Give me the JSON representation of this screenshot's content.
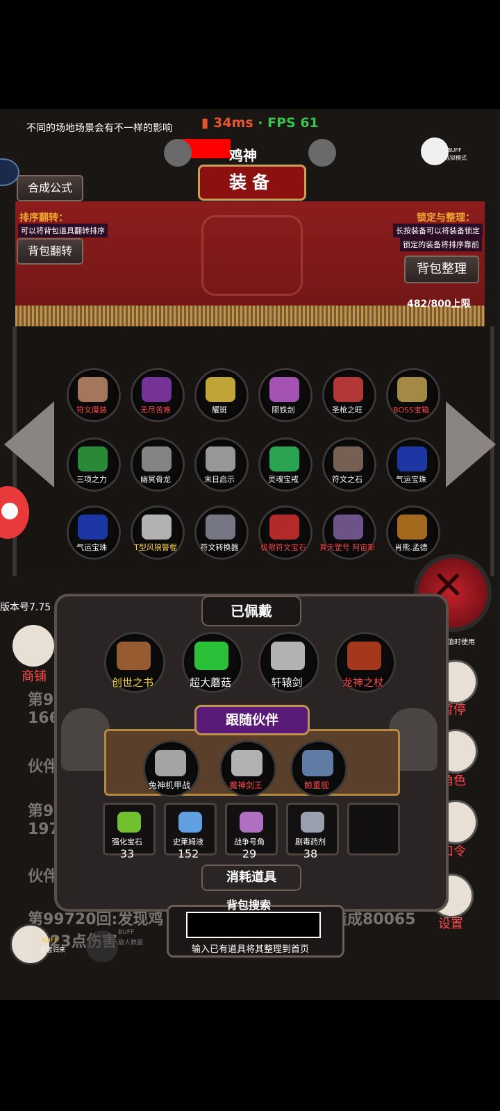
{
  "status": {
    "tip": "不同的场地场景会有不一样的影响",
    "ping": "34ms",
    "separator": " · ",
    "fps": "FPS 61"
  },
  "header": {
    "player_name": "鸡神",
    "title": "装备",
    "buff_label": "BUFF",
    "mode_label": "炼狱模式"
  },
  "left_buttons": {
    "synthesis": "合成公式",
    "sort_title": "排序翻转：",
    "sort_hint": "可以将背包道具翻转排序",
    "flip": "背包翻转"
  },
  "right_buttons": {
    "lock_title": "锁定与整理：",
    "lock_hint1": "长按装备可以将装备锁定",
    "lock_hint2": "锁定的装备将排序靠前",
    "organize": "背包整理",
    "capacity": "482/800上限"
  },
  "inventory": {
    "items": [
      {
        "name": "符文魔装",
        "color": "red",
        "icon_color": "#c08a6a"
      },
      {
        "name": "无尽苦难",
        "color": "red",
        "icon_color": "#8a3ab0"
      },
      {
        "name": "耀斑",
        "color": "white",
        "icon_color": "#e0c040"
      },
      {
        "name": "陨铁剑",
        "color": "white",
        "icon_color": "#c060d0"
      },
      {
        "name": "圣枪之旺",
        "color": "white",
        "icon_color": "#d04040"
      },
      {
        "name": "BOSS宝箱",
        "color": "red",
        "icon_color": "#c0a050"
      },
      {
        "name": "三项之力",
        "color": "white",
        "icon_color": "#30a040"
      },
      {
        "name": "幽冥骨龙",
        "color": "white",
        "icon_color": "#9a9a9a"
      },
      {
        "name": "末日启示",
        "color": "white",
        "icon_color": "#b0b0b0"
      },
      {
        "name": "灵魂宝戒",
        "color": "white",
        "icon_color": "#30c060"
      },
      {
        "name": "符文之石",
        "color": "white",
        "icon_color": "#8a7060"
      },
      {
        "name": "气运宝珠",
        "color": "white",
        "icon_color": "#2040c0"
      },
      {
        "name": "气运宝珠",
        "color": "white",
        "icon_color": "#2040c0"
      },
      {
        "name": "T型风狼警棍",
        "color": "yellow",
        "icon_color": "#d0d0d0"
      },
      {
        "name": "符文转换器",
        "color": "white",
        "icon_color": "#8a8a9a"
      },
      {
        "name": "极限符文宝石",
        "color": "red",
        "icon_color": "#d03030"
      },
      {
        "name": "真天罡号 阿宙斯",
        "color": "red",
        "icon_color": "#8060a0"
      },
      {
        "name": "肖熊.孟德",
        "color": "white",
        "icon_color": "#c07a20"
      }
    ]
  },
  "equipped": {
    "title": "已佩戴",
    "items": [
      {
        "name": "创世之书",
        "color": "yellow",
        "icon_color": "#b06a3a"
      },
      {
        "name": "超大蘑菇",
        "color": "white",
        "icon_color": "#30e040"
      },
      {
        "name": "轩辕剑",
        "color": "white",
        "icon_color": "#d0d0d0"
      },
      {
        "name": "龙神之杖",
        "color": "red",
        "icon_color": "#c04020"
      }
    ]
  },
  "partners": {
    "title": "跟随伙伴",
    "items": [
      {
        "name": "兔神机甲战",
        "color": "white",
        "icon_color": "#c0c0c0"
      },
      {
        "name": "魔神剑王",
        "color": "red",
        "icon_color": "#d0d0d0"
      },
      {
        "name": "鲸重舰",
        "color": "red",
        "icon_color": "#7090c0"
      }
    ]
  },
  "consumables": {
    "title": "消耗道具",
    "items": [
      {
        "name": "强化宝石",
        "count": "33",
        "icon_color": "#70c030"
      },
      {
        "name": "史莱姆液",
        "count": "152",
        "icon_color": "#60a0e0"
      },
      {
        "name": "战争号角",
        "count": "29",
        "icon_color": "#b070c0"
      },
      {
        "name": "剧毒药剂",
        "count": "38",
        "icon_color": "#9aa0b0"
      },
      {
        "name": "",
        "count": "",
        "icon_color": ""
      }
    ]
  },
  "search": {
    "title": "背包搜索",
    "hint": "输入已有道具将其整理到首页",
    "value": ""
  },
  "side": {
    "version": "版本号7.75",
    "shop": "商铺",
    "pause": "暂停",
    "role": "角色",
    "password": "口令",
    "settings": "设置",
    "score_text": "其数值时使用"
  },
  "log": {
    "line1": "第9",
    "line2": "166",
    "line3": "伙伴",
    "line4": "第9",
    "line5": "197",
    "line6": "伙伴",
    "line7a": "第99720回:发现鸡",
    "line7b": "造成80065",
    "line8": "23点伤害"
  },
  "bottom_buffs": {
    "buff1": "BUFF",
    "buff1_desc": "亡者归来",
    "buff2": "BUFF",
    "buff2_desc": "敌人数量"
  }
}
